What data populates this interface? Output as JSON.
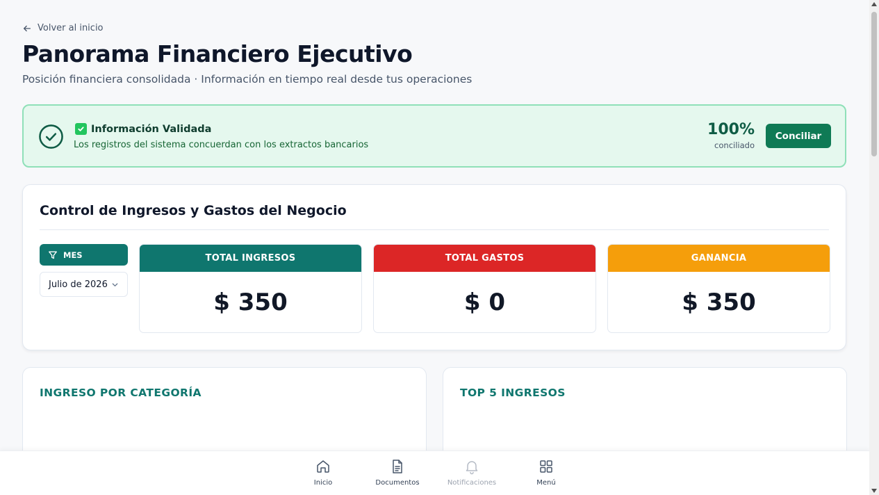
{
  "header": {
    "back_label": "Volver al inicio",
    "title": "Panorama Financiero Ejecutivo",
    "subtitle": "Posición financiera consolidada · Información en tiempo real desde tus operaciones"
  },
  "validation": {
    "title": "Información Validada",
    "description": "Los registros del sistema concuerdan con los extractos bancarios",
    "percent": "100%",
    "percent_label": "conciliado",
    "button_label": "Conciliar"
  },
  "control": {
    "title": "Control de Ingresos y Gastos del Negocio",
    "filter_label": "MES",
    "month_value": "Julio de 2026",
    "stats": [
      {
        "label": "TOTAL INGRESOS",
        "value": "$ 350",
        "color": "#0f766e"
      },
      {
        "label": "TOTAL GASTOS",
        "value": "$ 0",
        "color": "#dc2626"
      },
      {
        "label": "GANANCIA",
        "value": "$ 350",
        "color": "#f59e0b"
      }
    ]
  },
  "panels": {
    "left_title": "INGRESO POR CATEGORÍA",
    "right_title": "TOP 5 INGRESOS"
  },
  "nav": {
    "items": [
      {
        "label": "Inicio",
        "icon": "home-icon"
      },
      {
        "label": "Documentos",
        "icon": "document-icon"
      },
      {
        "label": "Notificaciones",
        "icon": "bell-icon"
      },
      {
        "label": "Menú",
        "icon": "grid-icon"
      }
    ]
  },
  "colors": {
    "accent_green": "#0f7a55",
    "teal": "#0f766e",
    "red": "#dc2626",
    "amber": "#f59e0b",
    "validated_bg": "#e5f8ee",
    "validated_border": "#8fe0b8"
  }
}
